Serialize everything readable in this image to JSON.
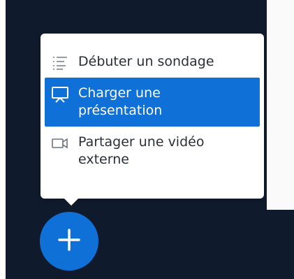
{
  "menu": {
    "items": [
      {
        "label": "Débuter un sondage",
        "icon": "poll-icon"
      },
      {
        "label": "Charger une présentation",
        "icon": "presentation-icon"
      },
      {
        "label": "Partager une vidéo externe",
        "icon": "video-icon"
      }
    ],
    "selected_index": 1
  },
  "fab": {
    "icon": "plus-icon"
  },
  "colors": {
    "accent": "#0f70d7",
    "dark": "#0f1b2d"
  }
}
